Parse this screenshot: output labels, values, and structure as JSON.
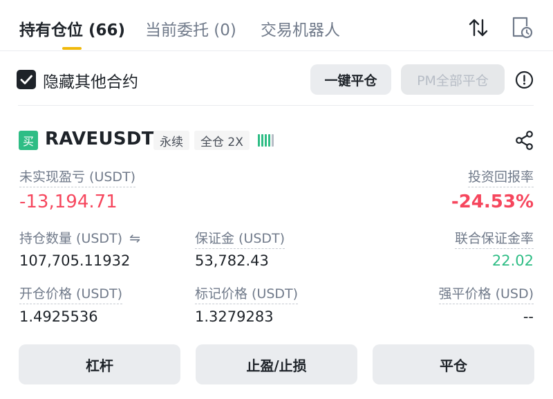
{
  "tabs": [
    {
      "label": "持有仓位 (66)",
      "active": true
    },
    {
      "label": "当前委托 (0)",
      "active": false
    },
    {
      "label": "交易机器人",
      "active": false
    }
  ],
  "toolbar": {
    "sort_icon": "sort-arrows-icon",
    "history_icon": "document-clock-icon"
  },
  "options": {
    "hide_other_contracts_label": "隐藏其他合约",
    "hide_other_contracts_checked": true,
    "close_all_label": "一键平仓",
    "pm_close_all_label": "PM全部平仓",
    "info_icon": "info-icon"
  },
  "position": {
    "side_badge": "买",
    "symbol": "RAVEUSDT",
    "contract_type": "永续",
    "margin_mode": "全仓 2X",
    "adl_level": 4,
    "unrealized_pnl_label": "未实现盈亏 (USDT)",
    "unrealized_pnl": "-13,194.71",
    "roi_label": "投资回报率",
    "roi": "-24.53%",
    "size_label": "持仓数量 (USDT)",
    "size_swap_icon": "⇋",
    "size": "107,705.11932",
    "margin_label": "保证金 (USDT)",
    "margin": "53,782.43",
    "margin_ratio_label": "联合保证金率",
    "margin_ratio": "22.02",
    "entry_price_label": "开仓价格 (USDT)",
    "entry_price": "1.4925536",
    "mark_price_label": "标记价格 (USDT)",
    "mark_price": "1.3279283",
    "liq_price_label": "强平价格 (USD)",
    "liq_price": "--"
  },
  "actions": {
    "leverage": "杠杆",
    "tp_sl": "止盈/止损",
    "close": "平仓"
  },
  "colors": {
    "accent": "#f0b90b",
    "buy": "#2ebd85",
    "loss": "#f6465d"
  }
}
